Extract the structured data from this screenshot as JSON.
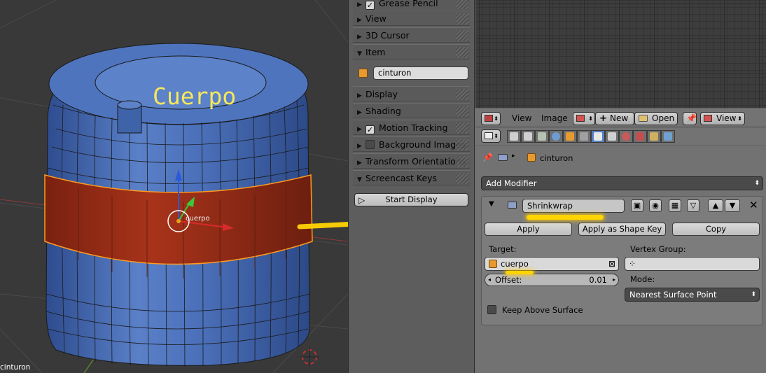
{
  "viewport": {
    "embossed_text": "Cuerpo",
    "pivot_label": "cuerpo",
    "active_object_label": "cinturon"
  },
  "npanel": {
    "sections": [
      {
        "label": "Grease Pencil",
        "expanded": false,
        "checkbox": true
      },
      {
        "label": "View",
        "expanded": false
      },
      {
        "label": "3D Cursor",
        "expanded": false
      },
      {
        "label": "Item",
        "expanded": true
      },
      {
        "label": "Display",
        "expanded": false
      },
      {
        "label": "Shading",
        "expanded": false
      },
      {
        "label": "Motion Tracking",
        "expanded": false,
        "checkbox": true
      },
      {
        "label": "Background Images",
        "expanded": false,
        "checkbox": false
      },
      {
        "label": "Transform Orientations",
        "expanded": false
      },
      {
        "label": "Screencast Keys",
        "expanded": true
      }
    ],
    "item_name": "cinturon",
    "start_display_label": "Start Display"
  },
  "image_editor": {
    "menu_view": "View",
    "menu_image": "Image",
    "new_label": "New",
    "open_label": "Open",
    "view_mode": "View"
  },
  "properties": {
    "context_object": "cinturon",
    "add_modifier_label": "Add Modifier",
    "modifier": {
      "name": "Shrinkwrap",
      "apply_label": "Apply",
      "apply_shape_key_label": "Apply as Shape Key",
      "copy_label": "Copy",
      "target_label": "Target:",
      "target_value": "cuerpo",
      "vertex_group_label": "Vertex Group:",
      "vertex_group_value": "",
      "offset_label": "Offset:",
      "offset_value": "0.01",
      "mode_label": "Mode:",
      "mode_value": "Nearest Surface Point",
      "keep_above_label": "Keep Above Surface",
      "keep_above_checked": false
    }
  },
  "colors": {
    "mesh_blue": "#4a6fb8",
    "belt_red": "#9a2b14",
    "annotation_yellow": "#ffd400",
    "active_tab_blue": "#5680c2"
  }
}
